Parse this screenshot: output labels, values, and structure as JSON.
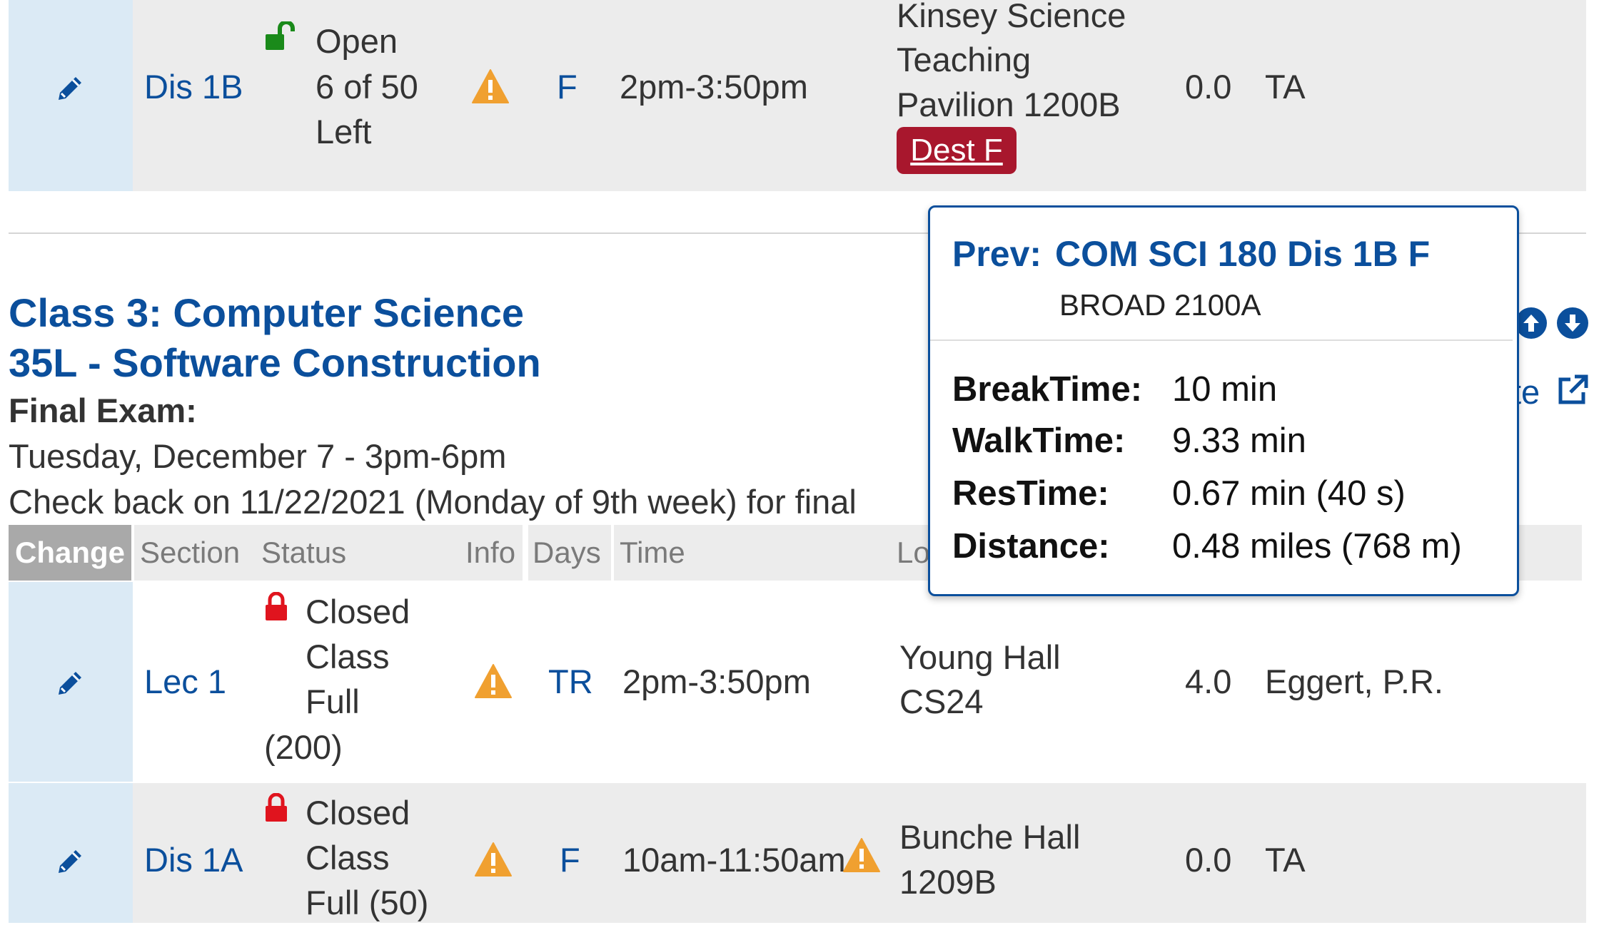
{
  "row_top": {
    "section": "Dis 1B",
    "status_lines": [
      "Open",
      "6 of 50",
      "Left"
    ],
    "days": "F",
    "time": "2pm-3:50pm",
    "location_lines": [
      "Kinsey Science",
      "Teaching",
      "Pavilion 1200B"
    ],
    "dest_badge": "Dest F",
    "units": "0.0",
    "instructor": "TA"
  },
  "class3": {
    "title_line1": "Class 3: Computer Science",
    "title_line2": "35L - Software Construction",
    "final_exam_label": "Final Exam:",
    "final_exam_date": "Tuesday, December 7 - 3pm-6pm",
    "check_back": "Check back on 11/22/2021 (Monday of 9th week) for final",
    "right_link_partial": "te"
  },
  "table_header": {
    "change": "Change",
    "section": "Section",
    "status": "Status",
    "info": "Info",
    "days": "Days",
    "time": "Time",
    "location": "Lo"
  },
  "rows": [
    {
      "section": "Lec 1",
      "status_lines": [
        "Closed",
        "Class",
        "Full",
        "(200)"
      ],
      "days": "TR",
      "time": "2pm-3:50pm",
      "location_lines": [
        "Young Hall",
        "CS24"
      ],
      "units": "4.0",
      "instructor": "Eggert, P.R."
    },
    {
      "section": "Dis 1A",
      "status_lines": [
        "Closed",
        "Class",
        "Full (50)"
      ],
      "days": "F",
      "time": "10am-11:50am",
      "location_lines": [
        "Bunche Hall",
        "1209B"
      ],
      "units": "0.0",
      "instructor": "TA"
    }
  ],
  "tooltip": {
    "prev_label": "Prev:",
    "prev_course": "COM SCI 180 Dis 1B F",
    "prev_location": "BROAD 2100A",
    "break_label": "BreakTime:",
    "break_value": "10 min",
    "walk_label": "WalkTime:",
    "walk_value": "9.33 min",
    "res_label": "ResTime:",
    "res_value": "0.67 min (40 s)",
    "dist_label": "Distance:",
    "dist_value": "0.48 miles (768 m)"
  },
  "icons": {
    "edit": "pencil-icon",
    "warning": "warning-icon",
    "open_lock": "unlock-icon",
    "closed_lock": "lock-icon",
    "move_up": "arrow-up-circle-icon",
    "move_down": "arrow-down-circle-icon",
    "external": "external-link-icon"
  },
  "colors": {
    "link_blue": "#0b4f9c",
    "warning_orange": "#f0a030",
    "open_green": "#1a8a1a",
    "closed_red": "#e0141e",
    "dest_badge": "#a8172d",
    "change_col_bg": "#dbeaf5",
    "row_bg": "#ececec"
  }
}
